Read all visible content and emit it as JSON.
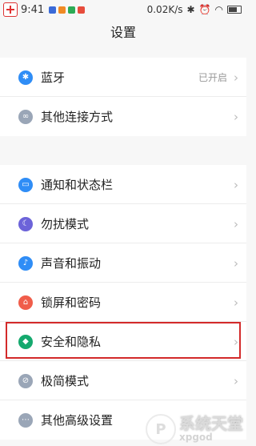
{
  "status_bar": {
    "time": "9:41",
    "network_speed": "0.02K/s"
  },
  "header": {
    "title": "设置",
    "partial_text": "……"
  },
  "group1": [
    {
      "name": "bluetooth",
      "icon": "bluetooth-icon",
      "label": "蓝牙",
      "value": "已开启",
      "color": "#2f8df6"
    },
    {
      "name": "other-connections",
      "icon": "link-icon",
      "label": "其他连接方式",
      "value": "",
      "color": "#9aa6b7"
    }
  ],
  "group2": [
    {
      "name": "notifications",
      "icon": "notification-icon",
      "label": "通知和状态栏",
      "value": "",
      "color": "#2f8df6"
    },
    {
      "name": "do-not-disturb",
      "icon": "moon-icon",
      "label": "勿扰模式",
      "value": "",
      "color": "#6c63d9"
    },
    {
      "name": "sound-vibration",
      "icon": "speaker-icon",
      "label": "声音和振动",
      "value": "",
      "color": "#2f8df6"
    },
    {
      "name": "lockscreen-password",
      "icon": "lock-icon",
      "label": "锁屏和密码",
      "value": "",
      "color": "#f05d4a"
    },
    {
      "name": "security-privacy",
      "icon": "shield-icon",
      "label": "安全和隐私",
      "value": "",
      "color": "#15a96e"
    },
    {
      "name": "minimal-mode",
      "icon": "minimal-icon",
      "label": "极简模式",
      "value": "",
      "color": "#9aa6b7"
    },
    {
      "name": "advanced-settings",
      "icon": "more-icon",
      "label": "其他高级设置",
      "value": "",
      "color": "#9aa6b7"
    }
  ],
  "watermark": {
    "text": "系统天堂",
    "sub": "xpgod"
  }
}
